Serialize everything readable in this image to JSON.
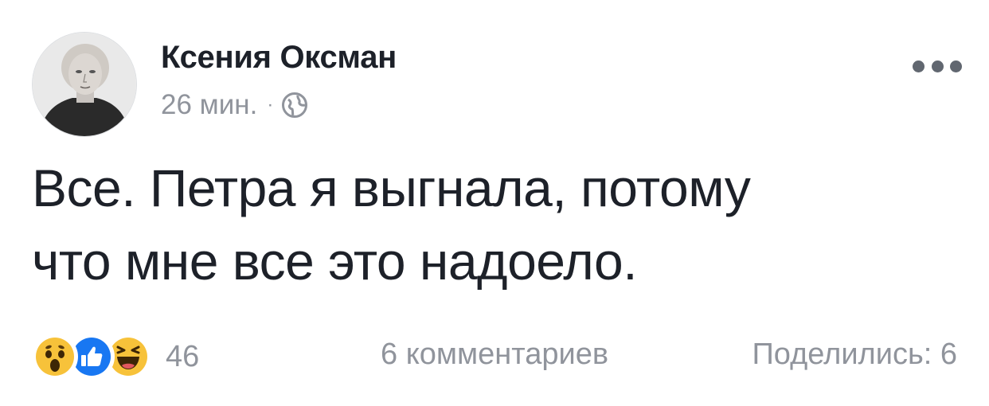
{
  "post": {
    "author_name": "Ксения Оксман",
    "timestamp": "26 мин.",
    "separator": "·",
    "privacy_icon": "globe-icon",
    "more_icon": "more-dots-icon",
    "text_lines": [
      "Все. Петра я выгнала, потому",
      "что мне все это надоело."
    ]
  },
  "footer": {
    "reaction_icons": [
      "wow-reaction-icon",
      "like-reaction-icon",
      "haha-reaction-icon"
    ],
    "reaction_count": "46",
    "comments": "6 комментариев",
    "shares": "Поделились: 6"
  },
  "colors": {
    "text": "#1d2129",
    "secondary": "#90949c",
    "like_blue": "#1877f2",
    "reaction_yellow": "#f7c23a",
    "dots": "#616770"
  }
}
